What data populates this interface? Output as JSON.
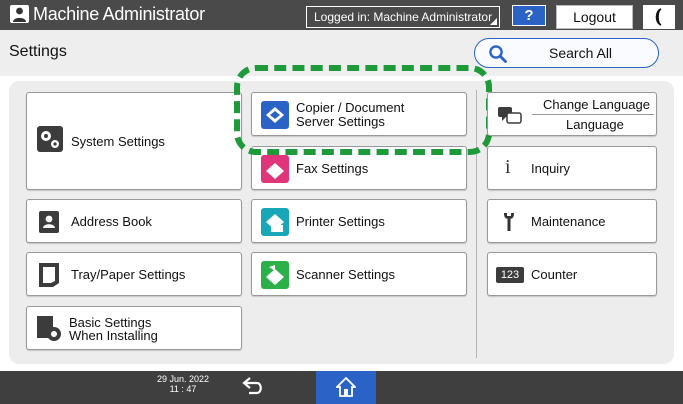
{
  "topbar": {
    "app_title": "Machine Administrator",
    "login_status": "Logged in: Machine Administrator",
    "help_label": "?",
    "logout_label": "Logout",
    "sleep_label": "(",
    "user_icon": "person-icon"
  },
  "header": {
    "title": "Settings",
    "search_label": "Search All",
    "search_icon": "search-icon"
  },
  "left_column": [
    {
      "label_line1": "System Settings",
      "label_line2": "",
      "icon": "gears-icon"
    },
    {
      "label_line1": "Address Book",
      "label_line2": "",
      "icon": "address-book-icon"
    },
    {
      "label_line1": "Tray/Paper Settings",
      "label_line2": "",
      "icon": "paper-tray-icon"
    },
    {
      "label_line1": "Basic Settings",
      "label_line2": "When Installing",
      "icon": "setup-gear-icon"
    }
  ],
  "middle_column": [
    {
      "label_line1": "Copier / Document",
      "label_line2": "Server Settings",
      "icon": "copier-icon"
    },
    {
      "label_line1": "Fax Settings",
      "label_line2": "",
      "icon": "fax-icon"
    },
    {
      "label_line1": "Printer Settings",
      "label_line2": "",
      "icon": "printer-icon"
    },
    {
      "label_line1": "Scanner Settings",
      "label_line2": "",
      "icon": "scanner-icon"
    }
  ],
  "right_column": {
    "change_language_title": "Change Language",
    "change_language_value": "Language",
    "items": [
      {
        "label": "Inquiry",
        "icon": "info-icon",
        "glyph": "i"
      },
      {
        "label": "Maintenance",
        "icon": "wrench-icon",
        "glyph": ""
      },
      {
        "label": "Counter",
        "icon": "counter-icon",
        "glyph": "123"
      }
    ]
  },
  "bottombar": {
    "date": "29 Jun. 2022",
    "time": "11 : 47",
    "back_icon": "back-arrow-icon",
    "home_icon": "home-icon"
  },
  "colors": {
    "accent_blue": "#2a63c5",
    "highlight_green": "#1e9a3b",
    "topbar_gray": "#4a4a4a"
  }
}
